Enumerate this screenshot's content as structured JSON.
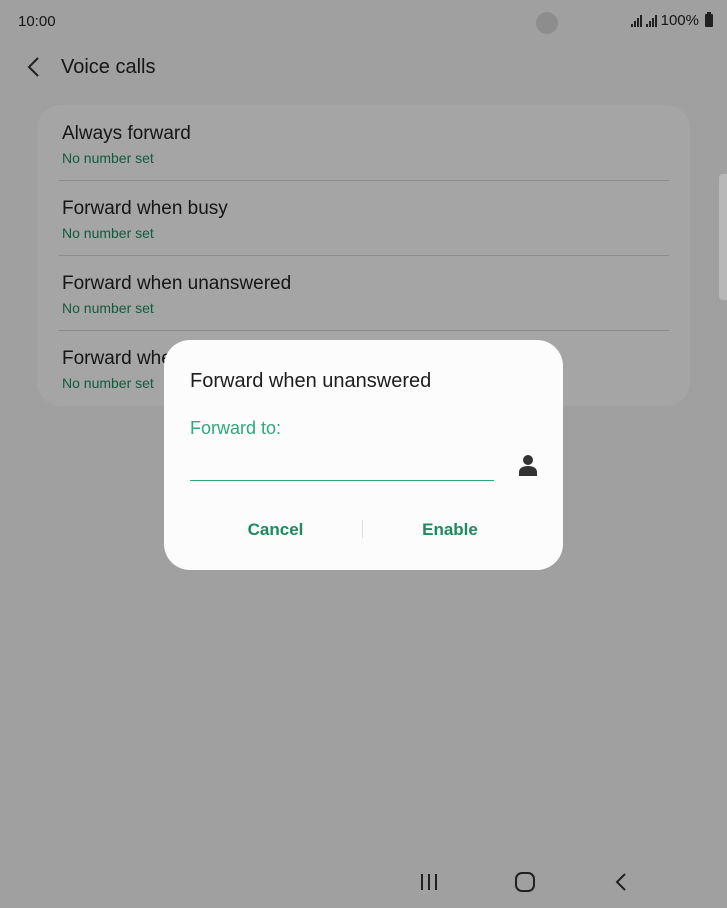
{
  "status_bar": {
    "time": "10:00",
    "battery_text": "100%"
  },
  "header": {
    "title": "Voice calls",
    "back_icon": "chevron-left-icon"
  },
  "forwarding_options": [
    {
      "title": "Always forward",
      "subtitle": "No number set"
    },
    {
      "title": "Forward when busy",
      "subtitle": "No number set"
    },
    {
      "title": "Forward when unanswered",
      "subtitle": "No number set"
    },
    {
      "title": "Forward when unreachable",
      "subtitle": "No number set"
    }
  ],
  "dialog": {
    "title": "Forward when unanswered",
    "field_label": "Forward to:",
    "field_value": "",
    "contact_icon": "person-icon",
    "cancel_label": "Cancel",
    "enable_label": "Enable"
  },
  "colors": {
    "accent": "#2fa87a",
    "subtitle_green": "#1e8a5f",
    "scrim": "rgba(0,0,0,0.345)"
  },
  "nav_bar": {
    "recents_icon": "recents-icon",
    "home_icon": "home-icon",
    "back_icon": "back-icon"
  }
}
